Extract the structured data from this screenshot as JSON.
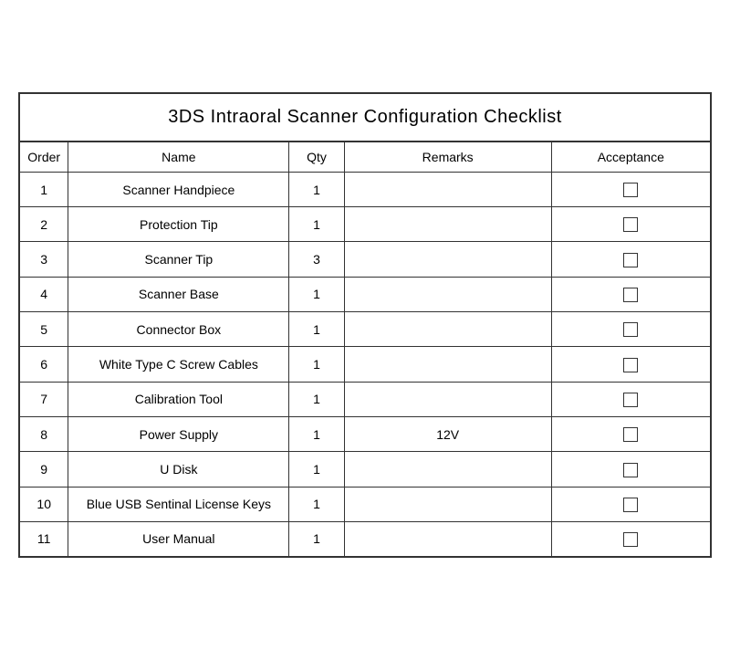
{
  "title": "3DS Intraoral Scanner Configuration Checklist",
  "columns": {
    "order": "Order",
    "name": "Name",
    "qty": "Qty",
    "remarks": "Remarks",
    "acceptance": "Acceptance"
  },
  "rows": [
    {
      "order": "1",
      "name": "Scanner Handpiece",
      "qty": "1",
      "remarks": ""
    },
    {
      "order": "2",
      "name": "Protection Tip",
      "qty": "1",
      "remarks": ""
    },
    {
      "order": "3",
      "name": "Scanner Tip",
      "qty": "3",
      "remarks": ""
    },
    {
      "order": "4",
      "name": "Scanner Base",
      "qty": "1",
      "remarks": ""
    },
    {
      "order": "5",
      "name": "Connector Box",
      "qty": "1",
      "remarks": ""
    },
    {
      "order": "6",
      "name": "White Type C Screw Cables",
      "qty": "1",
      "remarks": ""
    },
    {
      "order": "7",
      "name": "Calibration Tool",
      "qty": "1",
      "remarks": ""
    },
    {
      "order": "8",
      "name": "Power Supply",
      "qty": "1",
      "remarks": "12V"
    },
    {
      "order": "9",
      "name": "U Disk",
      "qty": "1",
      "remarks": ""
    },
    {
      "order": "10",
      "name": "Blue USB Sentinal License Keys",
      "qty": "1",
      "remarks": ""
    },
    {
      "order": "11",
      "name": "User Manual",
      "qty": "1",
      "remarks": ""
    }
  ]
}
